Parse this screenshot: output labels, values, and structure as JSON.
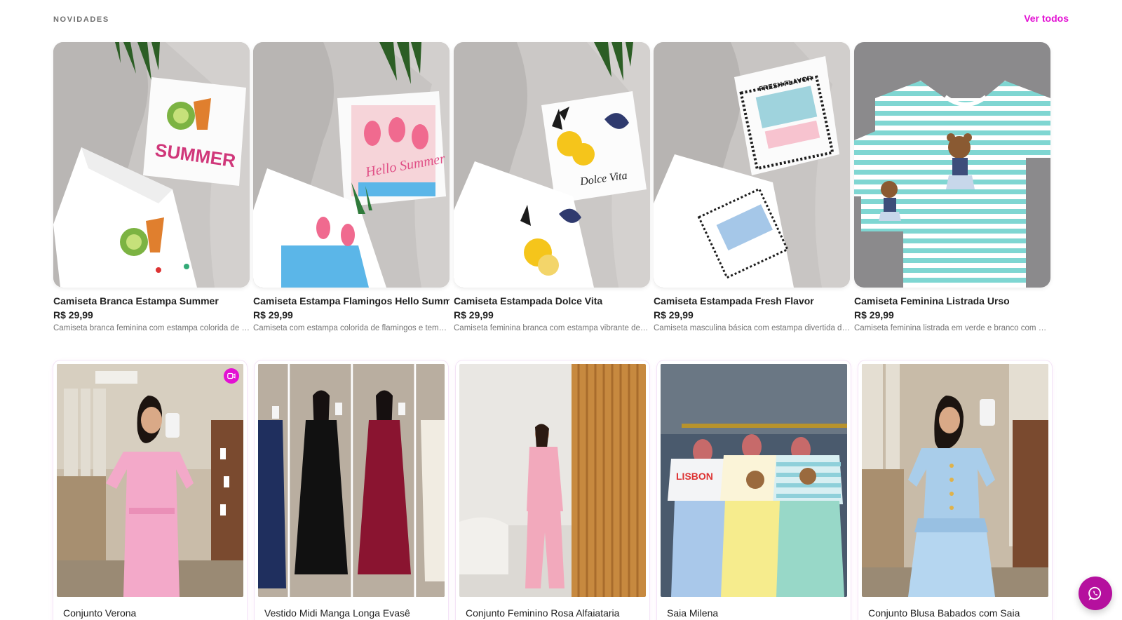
{
  "section": {
    "title": "NOVIDADES",
    "see_all": "Ver todos"
  },
  "products": [
    {
      "name": "Camiseta Branca Estampa Summer",
      "price": "R$ 29,99",
      "desc": "Camiseta branca feminina com estampa colorida de verão"
    },
    {
      "name": "Camiseta Estampa Flamingos Hello Summer",
      "price": "R$ 29,99",
      "desc": "Camiseta com estampa colorida de flamingos e tema de verão"
    },
    {
      "name": "Camiseta Estampada Dolce Vita",
      "price": "R$ 29,99",
      "desc": "Camiseta feminina branca com estampa vibrante de limões"
    },
    {
      "name": "Camiseta Estampada Fresh Flavor",
      "price": "R$ 29,99",
      "desc": "Camiseta masculina básica com estampa divertida de sardinhas"
    },
    {
      "name": "Camiseta Feminina Listrada Urso",
      "price": "R$ 29,99",
      "desc": "Camiseta feminina listrada em verde e branco com urso"
    }
  ],
  "videos": [
    {
      "name": "Conjunto Verona",
      "has_video_badge": true
    },
    {
      "name": "Vestido Midi Manga Longa Evasê",
      "has_video_badge": false
    },
    {
      "name": "Conjunto Feminino Rosa Alfaiataria",
      "has_video_badge": false
    },
    {
      "name": "Saia Milena",
      "has_video_badge": false
    },
    {
      "name": "Conjunto Blusa Babados com Saia",
      "has_video_badge": false
    }
  ],
  "colors": {
    "accent": "#e310d3",
    "whatsapp": "#b5109e"
  },
  "icons": {
    "video": "video-camera-icon",
    "whatsapp": "whatsapp-icon"
  }
}
